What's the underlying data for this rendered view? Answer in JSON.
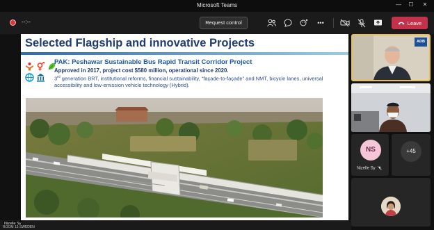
{
  "window": {
    "title": "Microsoft Teams",
    "controls": {
      "minimize": "—",
      "maximize": "☐",
      "close": "✕"
    }
  },
  "toolbar": {
    "timer": "--:--",
    "request_control_label": "Request control",
    "leave_label": "Leave",
    "leave_color": "#c4314b"
  },
  "slide": {
    "title": "Selected Flagship and innovative Projects",
    "project_title": "PAK: Peshawar Sustainable Bus Rapid Transit Corridor Project",
    "approved": "Approved in 2017, project cost $580 million, operational since 2020.",
    "desc_ordinal": "3",
    "desc_sup": "rd",
    "desc_rest": " generation BRT, institutional reforms, financial sustainability, “façade-to-façade” and NMT, bicycle lanes, universal accessibility and low-emission vehicle technology (Hybrid).",
    "icons": [
      "people-icon",
      "gender-equality-icon",
      "leaf-icon",
      "globe-icon",
      "institution-icon"
    ]
  },
  "participants": {
    "speaker_badge": "ADB",
    "ns_initials": "NS",
    "ns_name": "Nizelle Sy",
    "more_count": "+45",
    "self_label": "Nizelle Sy",
    "room_label": "ROOM 15 SWEDEN"
  }
}
